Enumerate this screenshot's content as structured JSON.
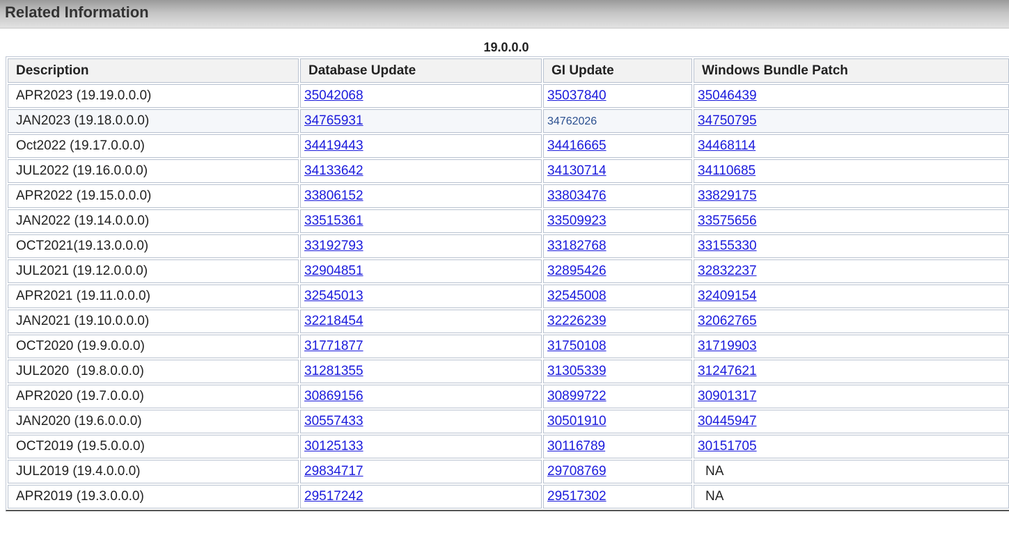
{
  "section": {
    "title": "Related Information"
  },
  "table": {
    "caption": "19.0.0.0",
    "headers": [
      "Description",
      "Database Update",
      "GI Update",
      "Windows Bundle Patch"
    ],
    "rows": [
      [
        "APR2023 (19.19.0.0.0)",
        "35042068",
        "35037840",
        "35046439"
      ],
      [
        "JAN2023 (19.18.0.0.0)",
        "34765931",
        "34762026",
        "34750795"
      ],
      [
        "Oct2022 (19.17.0.0.0)",
        "34419443",
        "34416665",
        "34468114"
      ],
      [
        "JUL2022 (19.16.0.0.0)",
        "34133642",
        "34130714",
        "34110685"
      ],
      [
        "APR2022 (19.15.0.0.0)",
        "33806152",
        "33803476",
        "33829175"
      ],
      [
        "JAN2022 (19.14.0.0.0)",
        "33515361",
        "33509923",
        "33575656"
      ],
      [
        "OCT2021(19.13.0.0.0)",
        "33192793",
        "33182768",
        "33155330"
      ],
      [
        "JUL2021 (19.12.0.0.0)",
        "32904851",
        "32895426",
        "32832237"
      ],
      [
        "APR2021 (19.11.0.0.0)",
        "32545013",
        "32545008",
        "32409154"
      ],
      [
        "JAN2021 (19.10.0.0.0)",
        "32218454",
        "32226239",
        "32062765"
      ],
      [
        "OCT2020 (19.9.0.0.0)",
        "31771877",
        "31750108",
        "31719903"
      ],
      [
        "JUL2020  (19.8.0.0.0)",
        "31281355",
        "31305339",
        "31247621"
      ],
      [
        "APR2020 (19.7.0.0.0)",
        "30869156",
        "30899722",
        "30901317"
      ],
      [
        "JAN2020 (19.6.0.0.0)",
        "30557433",
        "30501910",
        "30445947"
      ],
      [
        "OCT2019 (19.5.0.0.0)",
        "30125133",
        "30116789",
        "30151705"
      ],
      [
        "JUL2019 (19.4.0.0.0)",
        "29834717",
        "29708769",
        "NA"
      ],
      [
        "APR2019 (19.3.0.0.0)",
        "29517242",
        "29517302",
        "NA"
      ]
    ]
  },
  "colors": {
    "link": "#1a1adc",
    "plain_link": "#2a4f8f",
    "header_bg": "#f2f2f2",
    "cell_border": "#b9c2d0"
  }
}
